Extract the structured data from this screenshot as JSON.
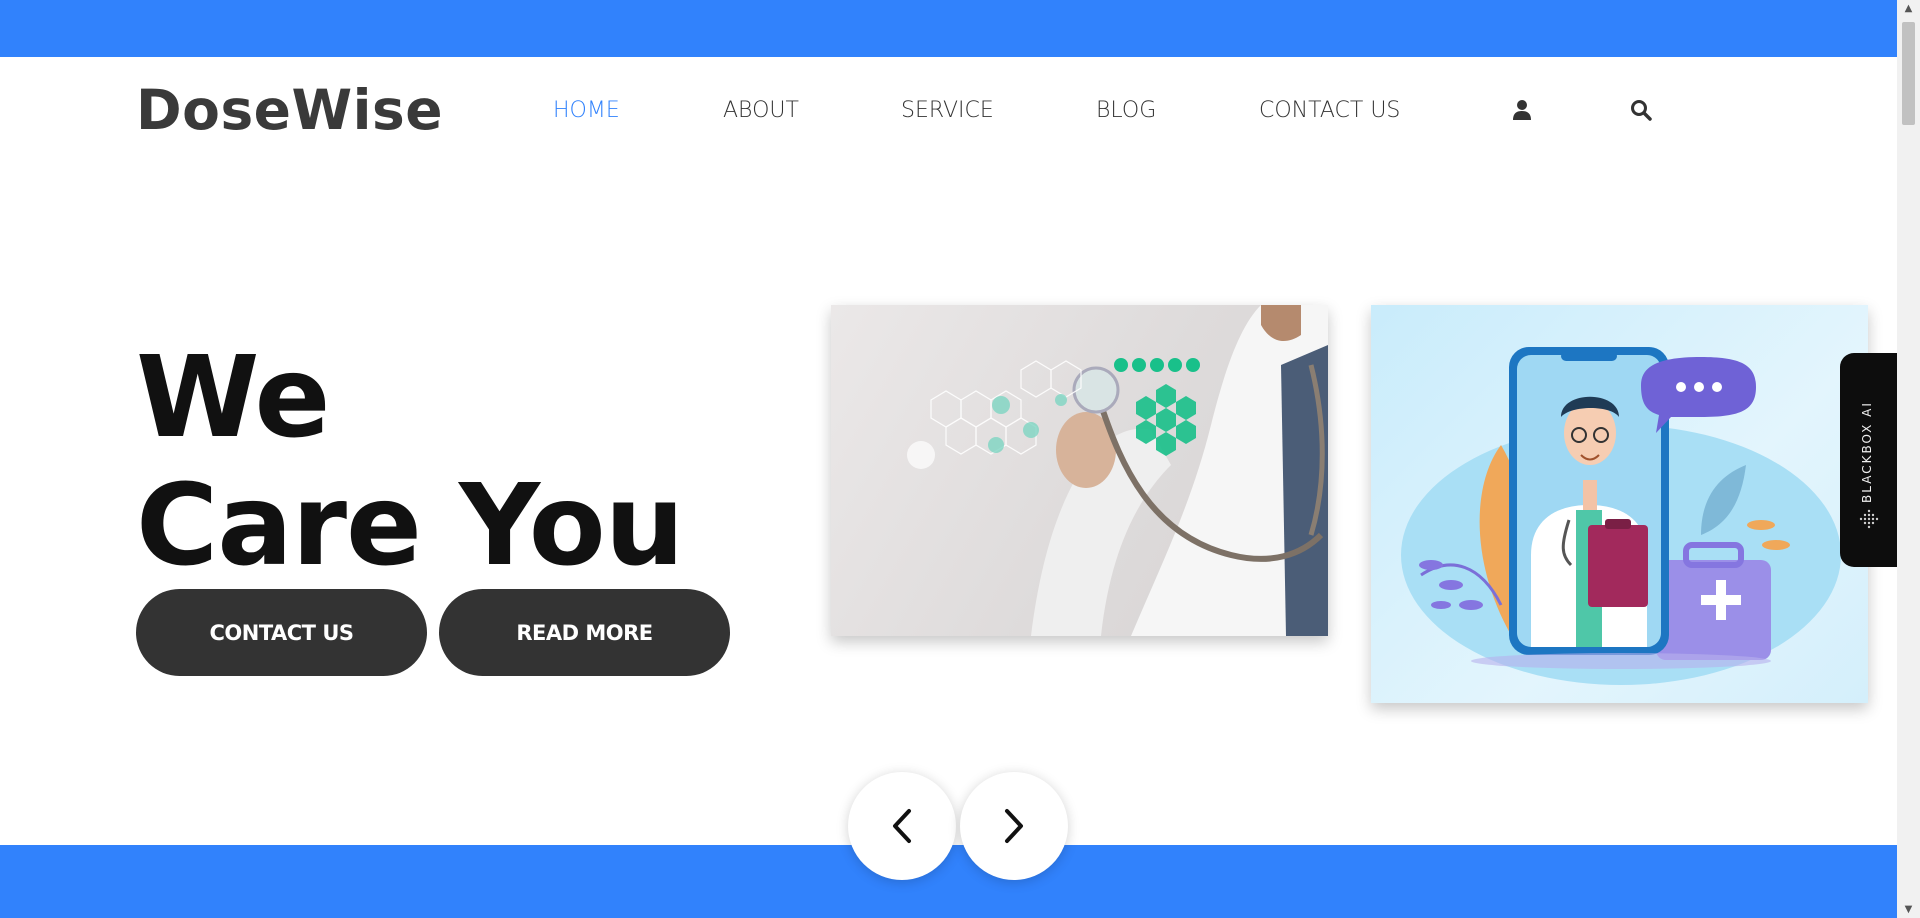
{
  "brand": {
    "name": "DoseWise",
    "accent_color": "#3182fc"
  },
  "nav": {
    "items": [
      {
        "label": "HOME",
        "active": true
      },
      {
        "label": "ABOUT",
        "active": false
      },
      {
        "label": "SERVICE",
        "active": false
      },
      {
        "label": "BLOG",
        "active": false
      },
      {
        "label": "CONTACT US",
        "active": false
      }
    ],
    "icons": [
      "user-icon",
      "search-icon"
    ]
  },
  "hero": {
    "title_line1": "We",
    "title_line2": "Care You",
    "buttons": {
      "contact": "CONTACT US",
      "read_more": "READ MORE"
    }
  },
  "carousel": {
    "slides": [
      "doctor-stethoscope-photo",
      "doctor-on-phone-illustration"
    ],
    "prev_icon": "chevron-left-icon",
    "next_icon": "chevron-right-icon"
  },
  "widget": {
    "label": "BLACKBOX AI"
  }
}
